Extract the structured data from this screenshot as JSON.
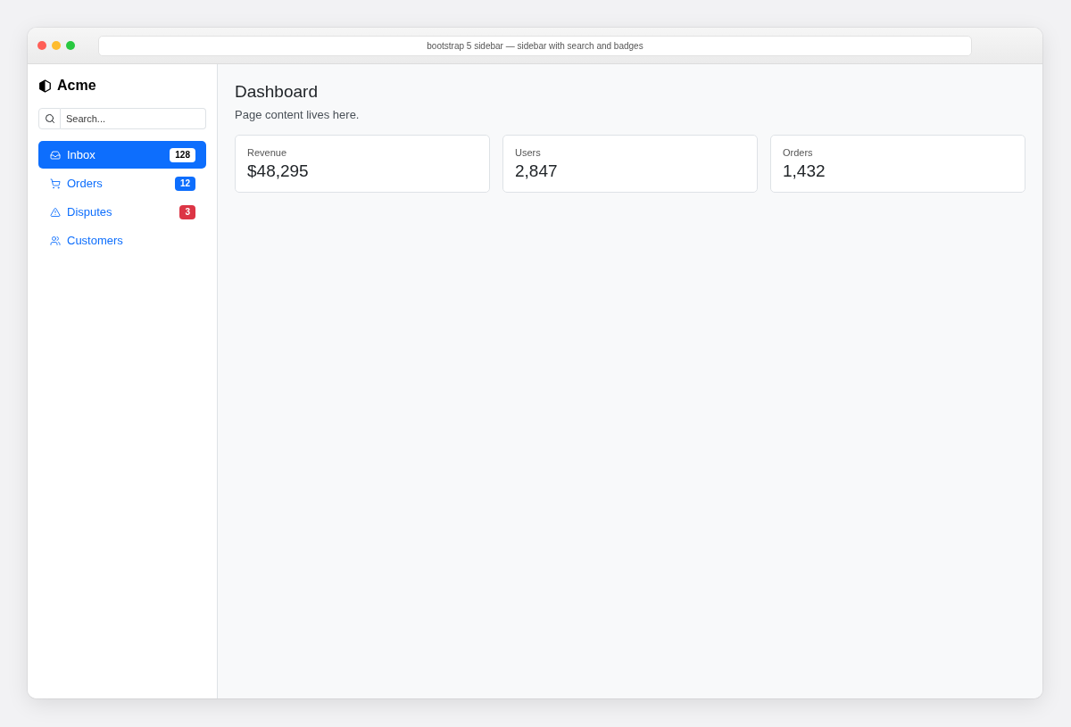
{
  "window": {
    "address": "bootstrap 5 sidebar — sidebar with search and badges"
  },
  "sidebar": {
    "brand": "Acme",
    "search": {
      "placeholder": "Search..."
    },
    "items": [
      {
        "label": "Inbox",
        "selected": true,
        "badge": {
          "text": "128",
          "color": "#ffffff"
        }
      },
      {
        "label": "Orders",
        "selected": false,
        "badge": {
          "text": "12",
          "color": "#0d6efd"
        }
      },
      {
        "label": "Disputes",
        "selected": false,
        "badge": {
          "text": "3",
          "color": "#dc3545"
        }
      },
      {
        "label": "Customers",
        "selected": false
      }
    ]
  },
  "main": {
    "heading": "Dashboard",
    "text": "Page content lives here.",
    "stats": [
      {
        "label": "Revenue",
        "value": "$48,295"
      },
      {
        "label": "Users",
        "value": "2,847"
      },
      {
        "label": "Orders",
        "value": "1,432"
      }
    ]
  }
}
